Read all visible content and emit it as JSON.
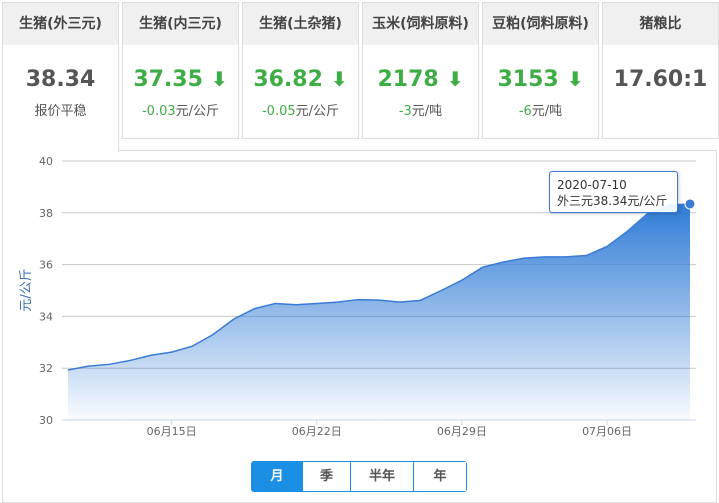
{
  "cards": [
    {
      "title": "生猪(外三元)",
      "value": "38.34",
      "sub": "报价平稳",
      "trend": "flat",
      "active": true
    },
    {
      "title": "生猪(内三元)",
      "value": "37.35",
      "change": "-0.03",
      "unit": "元/公斤",
      "trend": "down"
    },
    {
      "title": "生猪(土杂猪)",
      "value": "36.82",
      "change": "-0.05",
      "unit": "元/公斤",
      "trend": "down"
    },
    {
      "title": "玉米(饲料原料)",
      "value": "2178",
      "change": "-3",
      "unit": "元/吨",
      "trend": "down"
    },
    {
      "title": "豆粕(饲料原料)",
      "value": "3153",
      "change": "-6",
      "unit": "元/吨",
      "trend": "down"
    },
    {
      "title": "猪粮比",
      "value": "17.60:1",
      "trend": "none"
    }
  ],
  "tooltip": {
    "date": "2020-07-10",
    "text": "外三元38.34元/公斤"
  },
  "range_buttons": [
    {
      "label": "月",
      "active": true
    },
    {
      "label": "季"
    },
    {
      "label": "半年"
    },
    {
      "label": "年"
    }
  ],
  "colors": {
    "up_down_green": "#3fad46",
    "accent": "#1a8fe3",
    "line": "#3a7bd5"
  },
  "chart_data": {
    "type": "area",
    "ylabel": "元/公斤",
    "ylim": [
      30,
      40
    ],
    "yticks": [
      30,
      32,
      34,
      36,
      38,
      40
    ],
    "start_date": "06-10",
    "xtick_labels": [
      {
        "index": 5,
        "label": "06月15日"
      },
      {
        "index": 12,
        "label": "06月22日"
      },
      {
        "index": 19,
        "label": "06月29日"
      },
      {
        "index": 26,
        "label": "07月06日"
      }
    ],
    "values": [
      31.93,
      32.08,
      32.15,
      32.3,
      32.5,
      32.62,
      32.85,
      33.3,
      33.9,
      34.3,
      34.5,
      34.45,
      34.5,
      34.55,
      34.65,
      34.63,
      34.55,
      34.62,
      35.0,
      35.4,
      35.9,
      36.1,
      36.25,
      36.3,
      36.3,
      36.35,
      36.7,
      37.3,
      38.0,
      38.3,
      38.34
    ],
    "grid": true
  }
}
